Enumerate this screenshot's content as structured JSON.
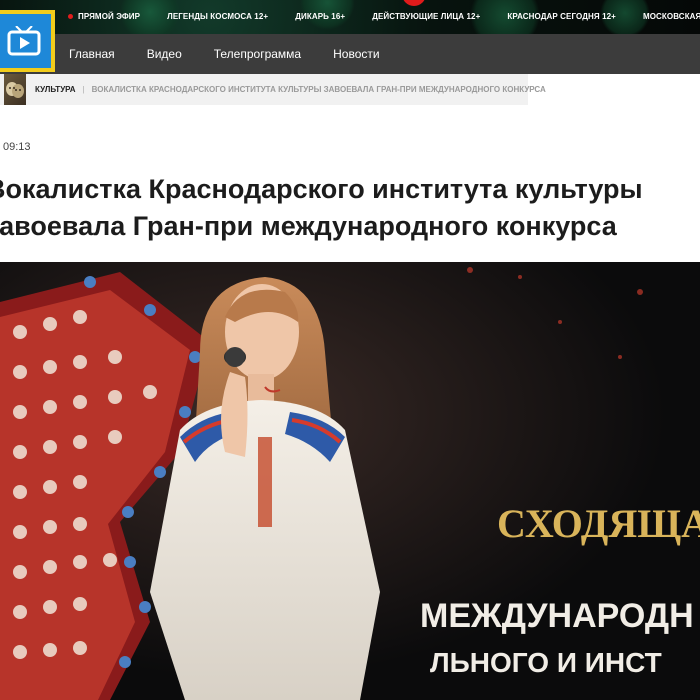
{
  "topnav": {
    "items": [
      {
        "label": "ПРЯМОЙ ЭФИР",
        "live": true
      },
      {
        "label": "ЛЕГЕНДЫ КОСМОСА 12+"
      },
      {
        "label": "ДИКАРЬ 16+"
      },
      {
        "label": "ДЕЙСТВУЮЩИЕ ЛИЦА 12+"
      },
      {
        "label": "КРАСНОДАР СЕГОДНЯ 12+"
      },
      {
        "label": "МОСКОВСКАЯ ПЛЕННИЦА"
      }
    ],
    "live_color": "#e21d1d"
  },
  "logo": {
    "icon": "tv-icon",
    "bg_color": "#1e88d8",
    "border_color": "#f2cc1b"
  },
  "mainnav": {
    "links": [
      "Главная",
      "Видео",
      "Телепрограмма",
      "Новости"
    ]
  },
  "breadcrumb": {
    "category": "КУЛЬТУРА",
    "separator": "|",
    "current": "ВОКАЛИСТКА КРАСНОДАРСКОГО ИНСТИТУТА КУЛЬТУРЫ ЗАВОЕВАЛА ГРАН-ПРИ МЕЖДУНАРОДНОГО КОНКУРСА"
  },
  "article": {
    "time": "09:13",
    "title_line1": "Вокалистка Краснодарского института культуры",
    "title_line2": "завоевала Гран-при международного конкурса"
  },
  "photo": {
    "stage_text_1": "СХОДЯЩАЯ",
    "stage_text_2": "МЕЖДУНАРОДН",
    "stage_text_3": "ЛЬНОГО И ИНСТ"
  }
}
